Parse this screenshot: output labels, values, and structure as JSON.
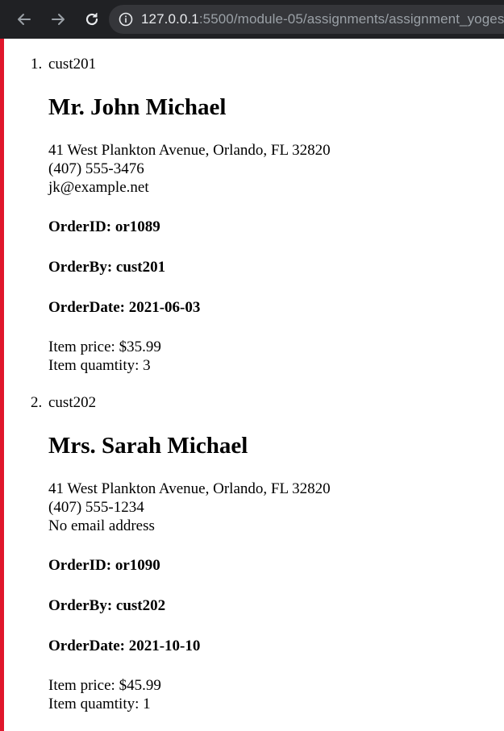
{
  "browser": {
    "url_host": "127.0.0.1",
    "url_rest": ":5500/module-05/assignments/assignment_yoges"
  },
  "customers": [
    {
      "number": "1.",
      "id": "cust201",
      "name": "Mr. John Michael",
      "address": "41 West Plankton Avenue, Orlando, FL 32820",
      "phone": "(407) 555-3476",
      "email": "jk@example.net",
      "order_id": "OrderID: or1089",
      "order_by": "OrderBy: cust201",
      "order_date": "OrderDate: 2021-06-03",
      "item_price": "Item price: $35.99",
      "item_quantity": "Item quamtity: 3"
    },
    {
      "number": "2.",
      "id": "cust202",
      "name": "Mrs. Sarah Michael",
      "address": "41 West Plankton Avenue, Orlando, FL 32820",
      "phone": "(407) 555-1234",
      "email": "No email address",
      "order_id": "OrderID: or1090",
      "order_by": "OrderBy: cust202",
      "order_date": "OrderDate: 2021-10-10",
      "item_price": "Item price: $45.99",
      "item_quantity": "Item quamtity: 1"
    }
  ]
}
